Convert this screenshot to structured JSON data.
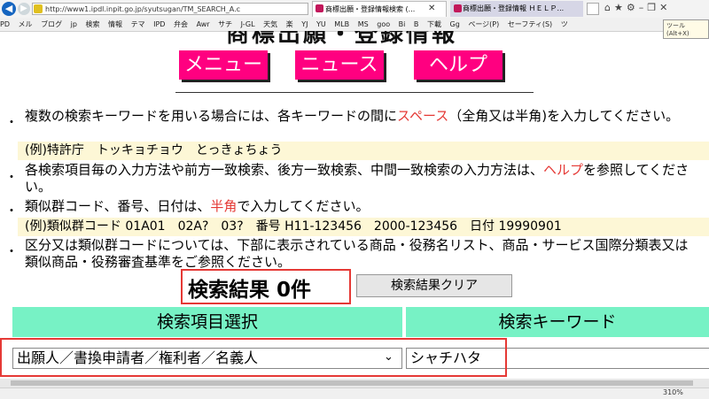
{
  "browser": {
    "address": "http://www1.ipdl.inpit.go.jp/syutsugan/TM_SEARCH_A.c",
    "tabs": [
      {
        "label": "商標出願・登録情報検索 (..."
      },
      {
        "label": "商標出願・登録情報 ＨＥＬＰ..."
      }
    ],
    "tooltip": "ツール (Alt+X)",
    "zoom": "310%",
    "favorites": [
      "PD",
      "メル",
      "ブログ",
      "jp",
      "検索",
      "情報",
      "テマ",
      "IPD",
      "弁会",
      "Awr",
      "サチ",
      "J-GL",
      "天気",
      "楽",
      "YJ",
      "YU",
      "MLB",
      "MS",
      "goo",
      "Bi",
      "B",
      "下載",
      "Gg",
      "ページ(P)",
      "セーフティ(S)",
      "ツ"
    ]
  },
  "page": {
    "heading": "商標出願・登録情報",
    "nav": {
      "menu": "メニュー",
      "news": "ニュース",
      "help": "ヘルプ"
    },
    "para1_a": "複数の検索キーワードを用いる場合には、各キーワードの間に",
    "para1_red": "スペース",
    "para1_b": "（全角又は半角)を入力してください。",
    "example1": "(例)特許庁　トッキョチョウ　とっきょちょう",
    "para2_a": "各検索項目毎の入力方法や前方一致検索、後方一致検索、中間一致検索の入力方法は、",
    "para2_red": "ヘルプ",
    "para2_b": "を参照してください。",
    "para3_a": "類似群コード、番号、日付は、",
    "para3_red": "半角",
    "para3_b": "で入力してください。",
    "example2": "(例)類似群コード 01A01　02A?　03?　番号 H11-123456　2000-123456　日付 19990901",
    "para4": "区分又は類似群コードについては、下部に表示されている商品・役務名リスト、商品・サービス国際分類表又は類似商品・役務審査基準をご参照ください。",
    "result": "検索結果 0件",
    "clear_button": "検索結果クリア",
    "table_headers": {
      "item_select": "検索項目選択",
      "keyword": "検索キーワード"
    },
    "selected_item": "出願人／書換申請者／権利者／名義人",
    "keyword_value": "シャチハタ"
  }
}
